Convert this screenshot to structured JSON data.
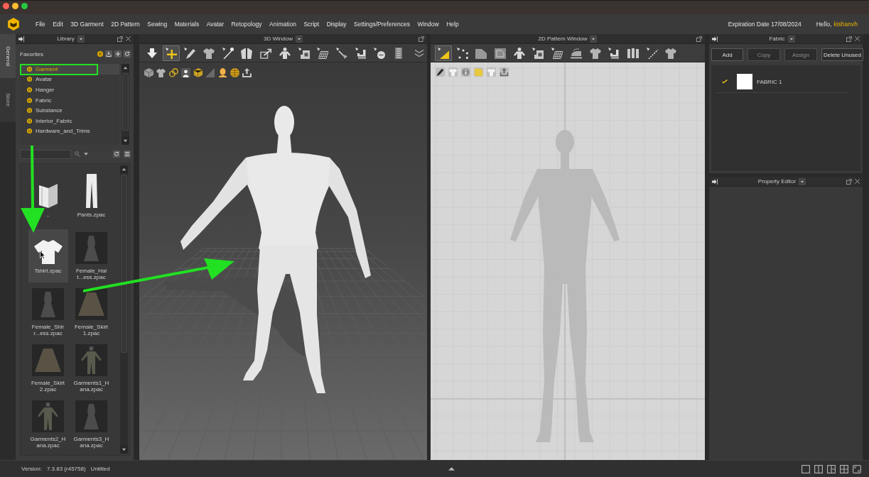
{
  "menu_bar": {
    "items": [
      "File",
      "Edit",
      "3D Garment",
      "2D Pattern",
      "Sewing",
      "Materials",
      "Avatar",
      "Retopology",
      "Animation",
      "Script",
      "Display",
      "Settings/Preferences",
      "Window",
      "Help"
    ],
    "expiration": "Expiration Date 17/08/2024",
    "greeting": "Hello,",
    "user": "kishanvh"
  },
  "side_tabs": [
    {
      "label": "General",
      "selected": true
    },
    {
      "label": "Store",
      "selected": false
    }
  ],
  "library": {
    "title": "Library",
    "favorites": {
      "label": "Favorites",
      "items": [
        {
          "label": "Garment",
          "selected": true,
          "highlighted": true
        },
        {
          "label": "Avatar",
          "selected": false,
          "highlighted": false
        },
        {
          "label": "Hanger",
          "selected": false,
          "highlighted": false
        },
        {
          "label": "Fabric",
          "selected": false,
          "highlighted": false
        },
        {
          "label": "Substance",
          "selected": false,
          "highlighted": false
        },
        {
          "label": "Interior_Fabric",
          "selected": false,
          "highlighted": false
        },
        {
          "label": "Hardware_and_Trims",
          "selected": false,
          "highlighted": false
        }
      ]
    },
    "files": [
      {
        "name": "..",
        "kind": "folder",
        "selected": false
      },
      {
        "name": "Pants.zpac",
        "kind": "pants",
        "selected": false
      },
      {
        "name": "Tshirt.zpac",
        "kind": "tshirt",
        "selected": true
      },
      {
        "name": "Female_Halt...ess.zpac",
        "kind": "dress",
        "selected": false
      },
      {
        "name": "Female_Shirr...ess.zpac",
        "kind": "dress",
        "selected": false
      },
      {
        "name": "Female_Skirt1.zpac",
        "kind": "skirt",
        "selected": false
      },
      {
        "name": "Female_Skirt2.zpac",
        "kind": "skirt",
        "selected": false
      },
      {
        "name": "Garments1_Hana.zpac",
        "kind": "outfit",
        "selected": false
      },
      {
        "name": "Garments2_Hana.zpac",
        "kind": "outfit",
        "selected": false
      },
      {
        "name": "Garments3_Hana.zpac",
        "kind": "dress",
        "selected": false
      }
    ]
  },
  "window_3d": {
    "title": "3D Window",
    "tools": [
      {
        "kind": "arrow-down",
        "selected": false
      },
      {
        "kind": "move",
        "selected": true
      },
      {
        "kind": "pen",
        "selected": false
      },
      {
        "kind": "shirt",
        "selected": false
      },
      {
        "kind": "needle",
        "selected": false
      },
      {
        "kind": "jacket",
        "selected": false
      },
      {
        "kind": "box",
        "selected": false
      },
      {
        "kind": "figure",
        "selected": false
      },
      {
        "kind": "fold",
        "selected": false
      },
      {
        "kind": "grid",
        "selected": false
      },
      {
        "kind": "tack",
        "selected": false
      },
      {
        "kind": "chair",
        "selected": false
      },
      {
        "kind": "circle",
        "selected": false
      },
      {
        "kind": "zipper",
        "selected": false
      }
    ]
  },
  "window_2d": {
    "title": "2D Pattern Window",
    "tools": [
      {
        "kind": "triangle",
        "selected": true
      },
      {
        "kind": "points",
        "selected": false
      },
      {
        "kind": "polygon",
        "selected": false
      },
      {
        "kind": "rectangle",
        "selected": false
      },
      {
        "kind": "figure",
        "selected": false
      },
      {
        "kind": "fold",
        "selected": false
      },
      {
        "kind": "grid",
        "selected": false
      },
      {
        "kind": "iron",
        "selected": false
      },
      {
        "kind": "shirt",
        "selected": false
      },
      {
        "kind": "chair",
        "selected": false
      },
      {
        "kind": "bars",
        "selected": false
      },
      {
        "kind": "line",
        "selected": false
      },
      {
        "kind": "shirt",
        "selected": false
      }
    ]
  },
  "fabric": {
    "title": "Fabric",
    "buttons": [
      {
        "label": "Add",
        "disabled": false
      },
      {
        "label": "Copy",
        "disabled": true
      },
      {
        "label": "Assign",
        "disabled": true
      },
      {
        "label": "Delete Unused",
        "disabled": false
      }
    ],
    "items": [
      {
        "name": "FABRIC 1",
        "checked": true,
        "color": "#ffffff"
      }
    ]
  },
  "property_editor": {
    "title": "Property Editor"
  },
  "annotations": [
    {
      "kind": "down"
    },
    {
      "kind": "right"
    }
  ],
  "status_bar": {
    "version_label": "Version:",
    "version": "7.3.83 (r45758)",
    "file": "Untitled"
  }
}
